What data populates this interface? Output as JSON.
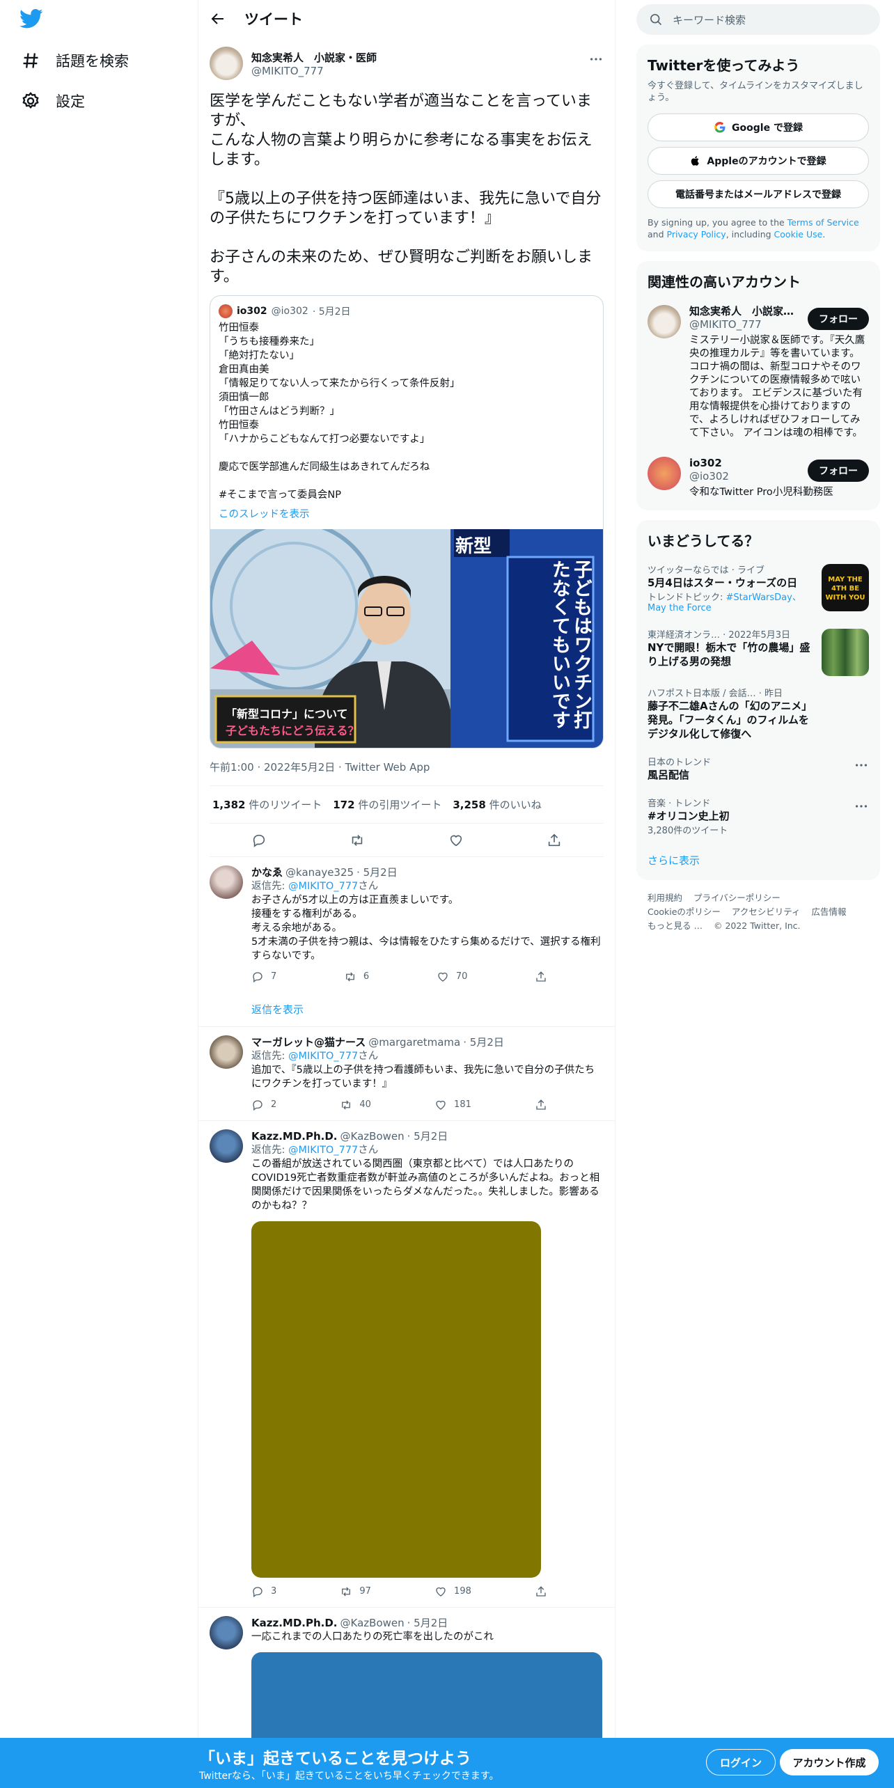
{
  "nav": {
    "explore_label": "話題を検索",
    "settings_label": "設定"
  },
  "header": {
    "title": "ツイート"
  },
  "main_tweet": {
    "author_name": "知念実希人　小説家・医師",
    "author_handle": "@MIKITO_777",
    "text": "医学を学んだこともない学者が適当なことを言っていますが、\nこんな人物の言葉より明らかに参考になる事実をお伝えします。\n\n『5歳以上の子供を持つ医師達はいま、我先に急いで自分の子供たちにワクチンを打っています！』\n\nお子さんの未来のため、ぜひ賢明なご判断をお願いします。",
    "quote": {
      "name": "io302",
      "handle": "@io302",
      "date": "· 5月2日",
      "text": "竹田恒泰\n「うちも接種券来た」\n「絶対打たない」\n倉田真由美\n「情報足りてない人って来たから行くって条件反射」\n須田慎一郎\n「竹田さんはどう判断？」\n竹田恒泰\n「ハナからこどもなんて打つ必要ないですよ」\n\n慶応で医学部進んだ同級生はあきれてんだろね\n\n#そこまで言って委員会NP",
      "thread_link": "このスレッドを表示",
      "image": {
        "side_label": "新型",
        "banner_text": "子どもはワクチン打たなくてもいいです",
        "caption_top": "「新型コロナ」について",
        "caption_bottom": "子どもたちにどう伝える？"
      }
    },
    "timestamp": "午前1:00 · 2022年5月2日 · Twitter Web App",
    "stats": {
      "retweets": "1,382",
      "retweets_label": "件のリツイート",
      "quotes": "172",
      "quotes_label": "件の引用ツイート",
      "likes": "3,258",
      "likes_label": "件のいいね"
    }
  },
  "replies": [
    {
      "name": "かなゑ",
      "handle": "@kanaye325",
      "date": "· 5月2日",
      "replying_prefix": "返信先: ",
      "replying_to": "@MIKITO_777",
      "replying_suffix": "さん",
      "text": "お子さんが5才以上の方は正直羨ましいです。\n接種をする権利がある。\n考える余地がある。\n5才未満の子供を持つ親は、今は情報をひたすら集めるだけで、選択する権利すらないです。",
      "replies": "7",
      "retweets": "6",
      "likes": "70"
    },
    {
      "name": "マーガレット@猫ナース",
      "handle": "@margaretmama",
      "date": "· 5月2日",
      "replying_prefix": "返信先: ",
      "replying_to": "@MIKITO_777",
      "replying_suffix": "さん",
      "text": "追加で、『5歳以上の子供を持つ看護師もいま、我先に急いで自分の子供たちにワクチンを打っています！』",
      "replies": "2",
      "retweets": "40",
      "likes": "181"
    },
    {
      "name": "Kazz.MD.Ph.D.",
      "handle": "@KazBowen",
      "date": "· 5月2日",
      "replying_prefix": "返信先: ",
      "replying_to": "@MIKITO_777",
      "replying_suffix": "さん",
      "text": "この番組が放送されている関西圏（東京都と比べて）では人口あたりのCOVID19死亡者数重症者数が軒並み高値のところが多いんだよね。おっと相関関係だけで因果関係をいったらダメなんだった。。失礼しました。影響あるのかもね？？",
      "replies": "3",
      "retweets": "97",
      "likes": "198"
    },
    {
      "name": "Kazz.MD.Ph.D.",
      "handle": "@KazBowen",
      "date": "· 5月2日",
      "text": "一応これまでの人口あたりの死亡率を出したのがこれ"
    }
  ],
  "show_replies_label": "返信を表示",
  "right": {
    "search_placeholder": "キーワード検索",
    "signup": {
      "title": "Twitterを使ってみよう",
      "desc": "今すぐ登録して、タイムラインをカスタマイズしましょう。",
      "google": "Google で登録",
      "apple": "Appleのアカウントで登録",
      "phone": "電話番号またはメールアドレスで登録",
      "legal_1": "By signing up, you agree to the ",
      "terms": "Terms of Service",
      "legal_2": " and ",
      "privacy": "Privacy Policy",
      "legal_3": ", including ",
      "cookie": "Cookie Use",
      "legal_4": "."
    },
    "accounts": {
      "title": "関連性の高いアカウント",
      "follow_label": "フォロー",
      "items": [
        {
          "name": "知念実希人　小説家…",
          "handle": "@MIKITO_777",
          "bio": "ミステリー小説家＆医師です。『天久鷹央の推理カルテ』等を書いています。 コロナ禍の間は、新型コロナやそのワクチンについての医療情報多めで呟いております。 エビデンスに基づいた有用な情報提供を心掛けておりますので、よろしければぜひフォローしてみて下さい。 アイコンは魂の相棒です。"
        },
        {
          "name": "io302",
          "handle": "@io302",
          "bio": "令和なTwitter Pro小児科勤務医"
        }
      ]
    },
    "trends": {
      "title": "いまどうしてる？",
      "show_more": "さらに表示",
      "items": [
        {
          "meta": "ツイッターならでは · ライブ",
          "name": "5月4日はスター・ウォーズの日",
          "sub_prefix": "トレンドトピック: ",
          "sub_link": "#StarWarsDay、May the Force",
          "image_text": "MAY THE 4TH BE WITH YOU"
        },
        {
          "meta": "東洋経済オンラ… · 2022年5月3日",
          "name": "NYで開眼！栃木で「竹の農場」盛り上げる男の発想"
        },
        {
          "meta": "ハフポスト日本版 / 会話… · 昨日",
          "name": "藤子不二雄Aさんの「幻のアニメ」発見。「フータくん」のフィルムをデジタル化して修復へ"
        },
        {
          "meta": "日本のトレンド",
          "name": "風呂配信"
        },
        {
          "meta": "音楽 · トレンド",
          "name": "#オリコン史上初",
          "sub": "3,280件のツイート"
        }
      ]
    },
    "footer": {
      "links": [
        "利用規約",
        "プライバシーポリシー",
        "Cookieのポリシー",
        "アクセシビリティ",
        "広告情報",
        "もっと見る …"
      ],
      "copyright": "© 2022 Twitter, Inc."
    }
  },
  "bottombar": {
    "headline": "「いま」起きていることを見つけよう",
    "sub": "Twitterなら、「いま」起きていることをいち早くチェックできます。",
    "login": "ログイン",
    "signup": "アカウント作成"
  },
  "colors": {
    "accent": "#1d9bf0",
    "dark": "#0f1419",
    "muted": "#536471",
    "reply_image_olive": "#817700",
    "reply_image_blue": "#2b78b6"
  }
}
